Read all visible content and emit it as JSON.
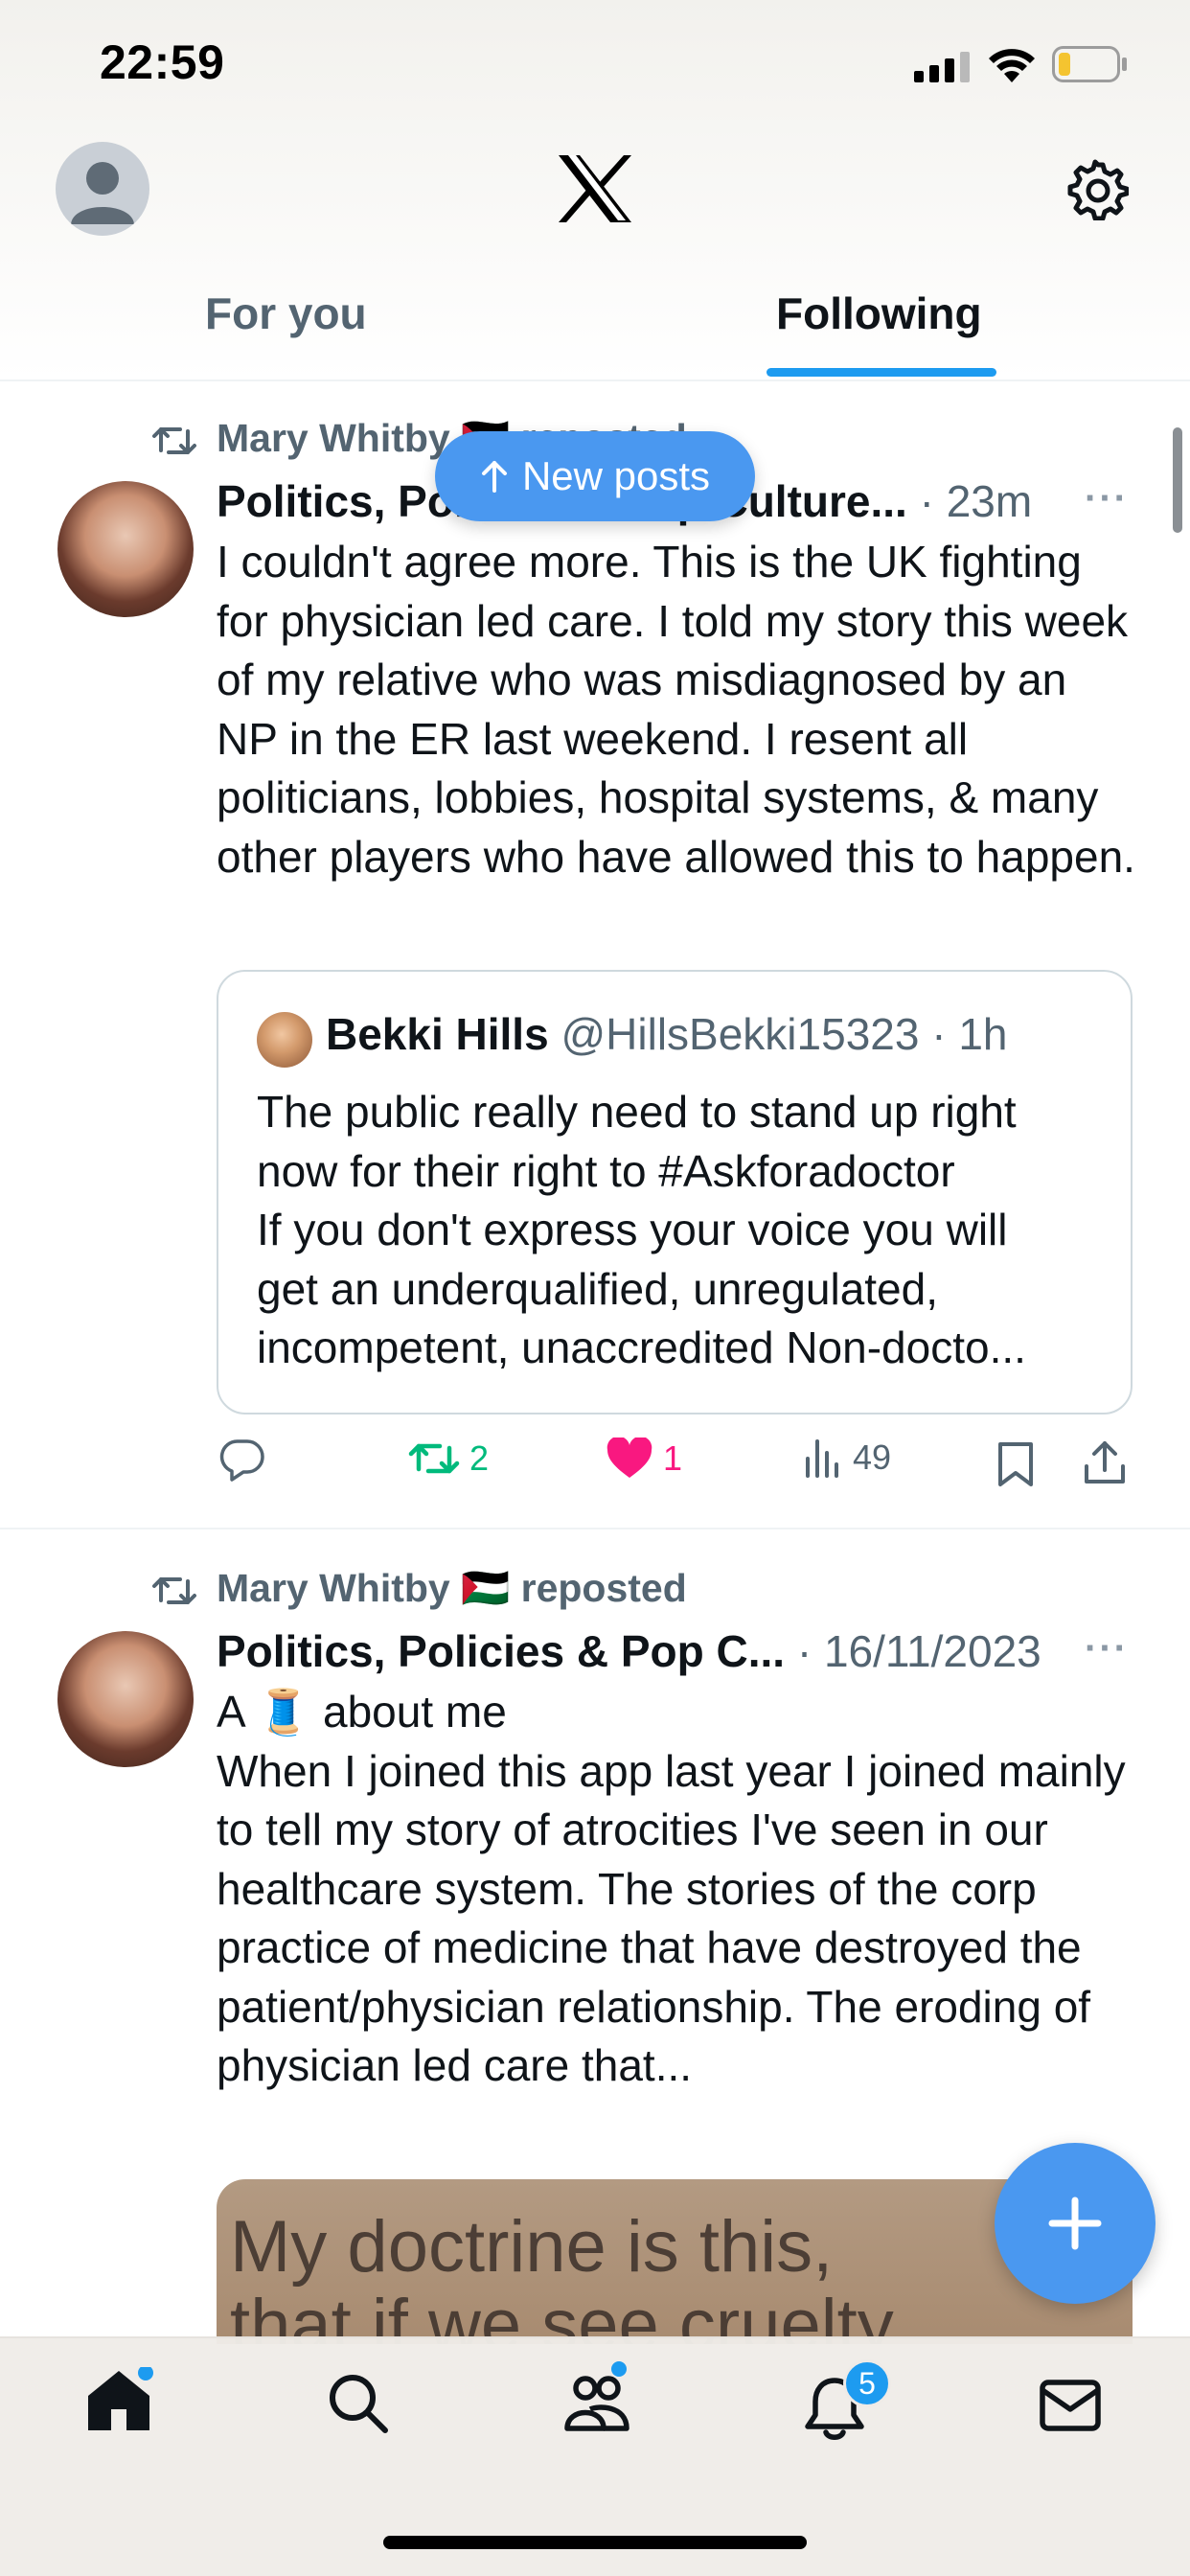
{
  "status_bar": {
    "time": "22:59"
  },
  "header": {
    "logo": "X",
    "avatar_icon": "default-avatar-icon",
    "settings_icon": "gear-icon"
  },
  "tabs": [
    {
      "label": "For you",
      "selected": false
    },
    {
      "label": "Following",
      "selected": true
    }
  ],
  "new_posts_pill": {
    "label": "New posts",
    "icon": "arrow-up-icon"
  },
  "posts": [
    {
      "repost_by": "Mary Whitby",
      "repost_flag": "🇵🇸",
      "repost_suffix": "reposted",
      "author_name": "Politics, Policies & Pop Culture...",
      "separator": "·",
      "time": "23m",
      "more": "···",
      "text": "I couldn't agree more. This is the UK fighting for physician led care. I told my story this week of my relative who was misdiagnosed by an NP in the ER last weekend. I resent all politicians, lobbies, hospital systems, & many other players who have allowed this to happen.",
      "quote": {
        "author_name": "Bekki Hills",
        "handle": "@HillsBekki15323",
        "separator": "·",
        "time": "1h",
        "text_lines": [
          "The public really need to stand up right",
          "now for their right to #Askforadoctor",
          "If you don't express your voice you will",
          "get an underqualified, unregulated,",
          "incompetent, unaccredited Non-docto..."
        ]
      },
      "actions": {
        "replies": "",
        "reposts": "2",
        "likes": "1",
        "views": "49"
      }
    },
    {
      "repost_by": "Mary Whitby",
      "repost_flag": "🇵🇸",
      "repost_suffix": "reposted",
      "author_name": "Politics, Policies & Pop C...",
      "separator": "·",
      "time": "16/11/2023",
      "more": "···",
      "text_line1_a": "A",
      "text_line1_emoji": "🧵",
      "text_line1_b": "about me",
      "text": "When I joined this app last year I joined mainly to tell my story of atrocities I've seen in our healthcare system. The stories of the corp practice of medicine that have destroyed the patient/physician relationship. The eroding of physician led care that...",
      "image_text_lines": [
        "My doctrine is this,",
        "that if we see cruelty"
      ]
    }
  ],
  "fab": {
    "icon": "plus-icon"
  },
  "bottom_nav": {
    "items": [
      "home-icon",
      "search-icon",
      "communities-icon",
      "notifications-icon",
      "messages-icon"
    ],
    "notifications_badge": "5"
  },
  "colors": {
    "accent": "#1d9bf0",
    "repost_green": "#00ba7c",
    "like_pink": "#f91880",
    "secondary_text": "#536471"
  }
}
